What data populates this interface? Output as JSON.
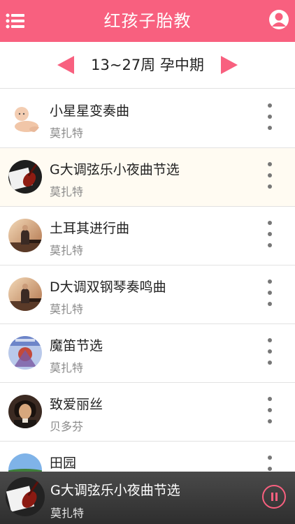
{
  "header": {
    "title": "红孩子胎教",
    "menu_icon": "menu-icon",
    "profile_icon": "user-icon"
  },
  "colors": {
    "accent": "#f8607f"
  },
  "week": {
    "label": "13~27周 孕中期"
  },
  "songs": [
    {
      "title": "小星星变奏曲",
      "artist": "莫扎特",
      "thumb": "baby"
    },
    {
      "title": "G大调弦乐小夜曲节选",
      "artist": "莫扎特",
      "thumb": "violin",
      "active": true
    },
    {
      "title": "土耳其进行曲",
      "artist": "莫扎特",
      "thumb": "pianist"
    },
    {
      "title": "D大调双钢琴奏鸣曲",
      "artist": "莫扎特",
      "thumb": "pianist"
    },
    {
      "title": "魔笛节选",
      "artist": "莫扎特",
      "thumb": "opera"
    },
    {
      "title": "致爱丽丝",
      "artist": "贝多芬",
      "thumb": "beethoven"
    },
    {
      "title": "田园",
      "artist": "",
      "thumb": "landscape"
    }
  ],
  "player": {
    "title": "G大调弦乐小夜曲节选",
    "artist": "莫扎特",
    "state_icon": "pause-icon"
  }
}
